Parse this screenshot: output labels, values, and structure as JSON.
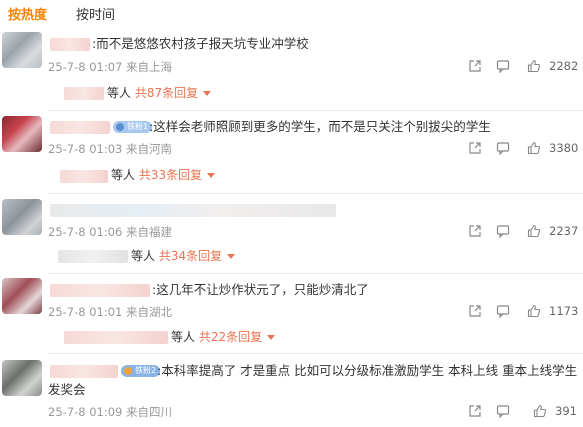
{
  "tabs": {
    "hot": "按热度",
    "time": "按时间"
  },
  "comments": [
    {
      "text": ":而不是悠悠农村孩子报天坑专业冲学校",
      "meta": "25-7-8 01:07 来自上海",
      "reply_who": "等人",
      "reply_count": "共87条回复",
      "likes": "2282"
    },
    {
      "badge": "铁粉1",
      "text": ":这样会老师照顾到更多的学生，而不是只关注个别拔尖的学生",
      "meta": "25-7-8 01:03 来自河南",
      "reply_who": "等人",
      "reply_count": "共33条回复",
      "likes": "3380"
    },
    {
      "meta": "25-7-8 01:06 来自福建",
      "reply_who": "等人",
      "reply_count": "共34条回复",
      "likes": "2237"
    },
    {
      "text": ":这几年不让炒作状元了，只能炒清北了",
      "meta": "25-7-8 01:01 来自湖北",
      "reply_who": "等人",
      "reply_count": "共22条回复",
      "likes": "1173"
    },
    {
      "badge": "铁粉2",
      "text_line1": ":本科率提高了 才是重点 比如可以分级标准激励学生 本科上线 重本上线学生",
      "text_line2": "发奖会",
      "meta": "25-7-8 01:09 来自四川",
      "likes": "391"
    }
  ],
  "icons": [
    "share-icon",
    "comment-icon",
    "like-icon"
  ]
}
